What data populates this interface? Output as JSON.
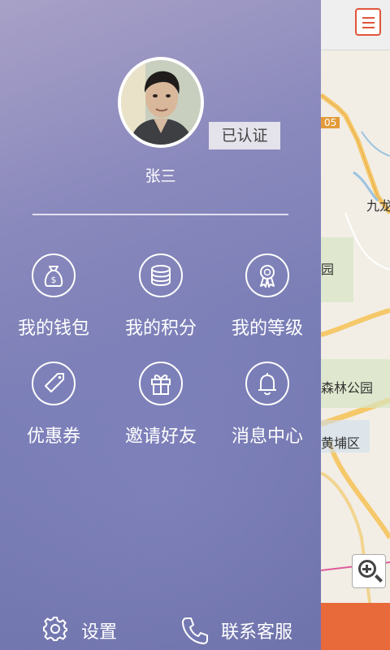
{
  "profile": {
    "name": "张三",
    "verified_label": "已认证"
  },
  "menu": [
    {
      "label": "我的钱包",
      "icon": "wallet-icon"
    },
    {
      "label": "我的积分",
      "icon": "coins-icon"
    },
    {
      "label": "我的等级",
      "icon": "medal-icon"
    },
    {
      "label": "优惠券",
      "icon": "coupon-tag-icon"
    },
    {
      "label": "邀请好友",
      "icon": "gift-icon"
    },
    {
      "label": "消息中心",
      "icon": "bell-icon"
    }
  ],
  "footer": {
    "settings_label": "设置",
    "contact_label": "联系客服"
  },
  "map": {
    "labels": [
      "05",
      "九龙",
      "园",
      "森林公园",
      "黄埔区"
    ]
  },
  "colors": {
    "drawer_top": "#a8a1c7",
    "drawer_bottom": "#6f73ab",
    "accent": "#e86a3a"
  }
}
